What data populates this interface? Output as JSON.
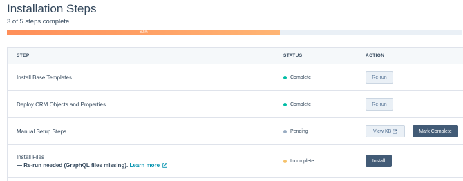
{
  "page": {
    "title": "Installation Steps",
    "subtitle": "3 of 5 steps complete"
  },
  "progress": {
    "percent": 60,
    "label": "60%"
  },
  "table": {
    "headers": {
      "step": "STEP",
      "status": "STATUS",
      "action": "ACTION"
    },
    "rows": [
      {
        "step": "Install Base Templates",
        "status": "Complete",
        "status_color": "#00bda5",
        "actions": [
          "Re-run"
        ]
      },
      {
        "step": "Deploy CRM Objects and Properties",
        "status": "Complete",
        "status_color": "#00bda5",
        "actions": [
          "Re-run"
        ]
      },
      {
        "step": "Manual Setup Steps",
        "status": "Pending",
        "status_color": "#99acc2",
        "actions": [
          "View KB",
          "Mark Complete"
        ]
      },
      {
        "step": "Install Files",
        "step_note": "— Re-run needed (GraphQL files missing).",
        "link": "Learn more",
        "status": "Incomplete",
        "status_color": "#f5c26b",
        "actions": [
          "Install"
        ]
      }
    ]
  },
  "icons": {
    "external_link": "external-link-icon"
  },
  "colors": {
    "progress_start": "#ff8f59",
    "progress_end": "#ffb574",
    "primary_button": "#425b76",
    "link": "#0091ae"
  }
}
